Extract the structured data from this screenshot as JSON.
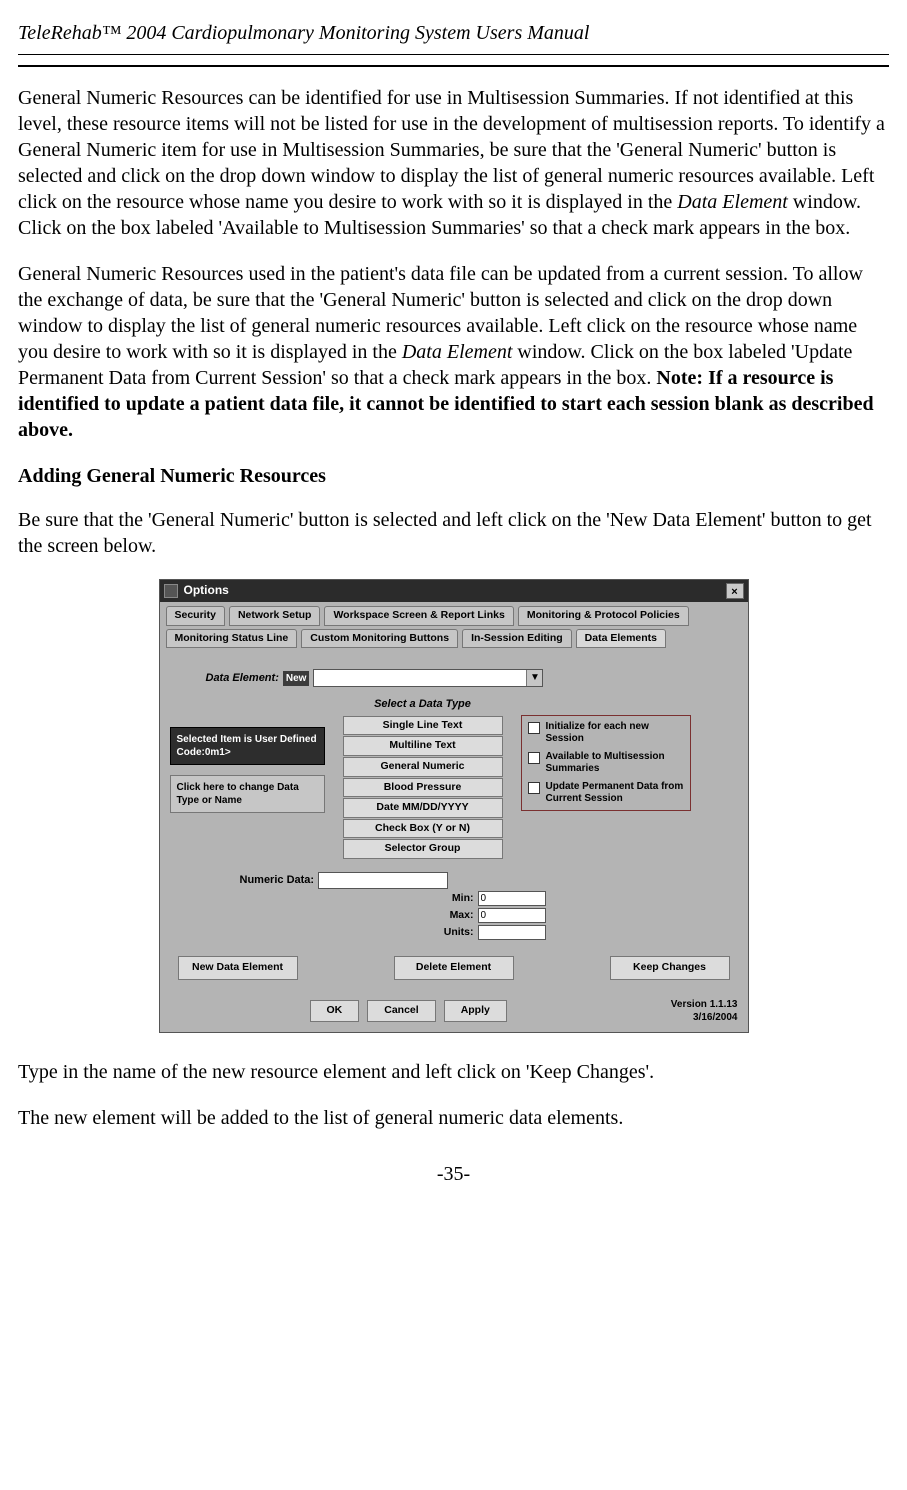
{
  "header": {
    "title_prefix": "TeleRehab",
    "title_tm": "™",
    "title_suffix": " 2004 Cardiopulmonary Monitoring System Users Manual"
  },
  "paragraphs": {
    "p1_a": "General Numeric Resources can be identified for use in Multisession Summaries. If not identified at this level, these resource items will not be listed for use in the development of multisession reports. To identify a General Numeric item for use in Multisession Summaries, be sure that the 'General Numeric' button is selected and click on the drop down window to display the list of general numeric resources available. Left click on the resource whose name you desire to work with so it is displayed in the ",
    "p1_i": "Data Element",
    "p1_b": " window.  Click on the box labeled 'Available to Multisession Summaries' so that a check mark appears in the box.",
    "p2_a": "General Numeric Resources used in the patient's data file can be updated from a current session. To allow the exchange of data, be sure that the 'General Numeric' button is selected and click on the drop down window to display the list of general numeric resources available. Left click on the resource whose name you desire to work with so it is displayed in the ",
    "p2_i": "Data Element",
    "p2_b": " window.  Click on the box labeled 'Update Permanent Data from Current Session' so that a check mark appears in the box. ",
    "p2_bold": "Note: If a resource is identified to update a patient data file, it cannot be identified to start each session blank as described above.",
    "subhead": "Adding General Numeric Resources",
    "p3": "Be sure that the 'General Numeric' button is selected and left click on the 'New Data Element' button to get the screen below.",
    "p4": "Type in the name of the new resource element and left click on 'Keep Changes'.",
    "p5": "The new element will be added to the list of general numeric data elements."
  },
  "screenshot": {
    "window_title": "Options",
    "close_glyph": "×",
    "tabs_row1": [
      "Security",
      "Network Setup",
      "Workspace Screen & Report Links",
      "Monitoring & Protocol Policies"
    ],
    "tabs_row2": [
      "Monitoring Status Line",
      "Custom Monitoring Buttons",
      "In-Session Editing",
      "Data Elements"
    ],
    "active_tab_index_row2": 3,
    "data_element_label": "Data Element:",
    "data_element_value": "New",
    "select_type_label": "Select a Data Type",
    "data_types": [
      "Single Line Text",
      "Multiline Text",
      "General Numeric",
      "Blood Pressure",
      "Date MM/DD/YYYY",
      "Check Box (Y or N)",
      "Selector Group"
    ],
    "left_box1": "Selected Item is  User Defined  Code:0m1>",
    "left_box2": "Click here to change Data Type or Name",
    "checks": [
      "Initialize for each new Session",
      "Available to Multisession Summaries",
      "Update Permanent Data from Current Session"
    ],
    "numeric_data_label": "Numeric Data:",
    "min_label": "Min:",
    "max_label": "Max:",
    "units_label": "Units:",
    "min_val": "0",
    "max_val": "0",
    "units_val": "",
    "bottom_buttons": [
      "New Data Element",
      "Delete Element",
      "Keep Changes"
    ],
    "ok_btn": "OK",
    "cancel_btn": "Cancel",
    "apply_btn": "Apply",
    "version_line1": "Version 1.1.13",
    "version_line2": "3/16/2004"
  },
  "page_number": "-35-"
}
